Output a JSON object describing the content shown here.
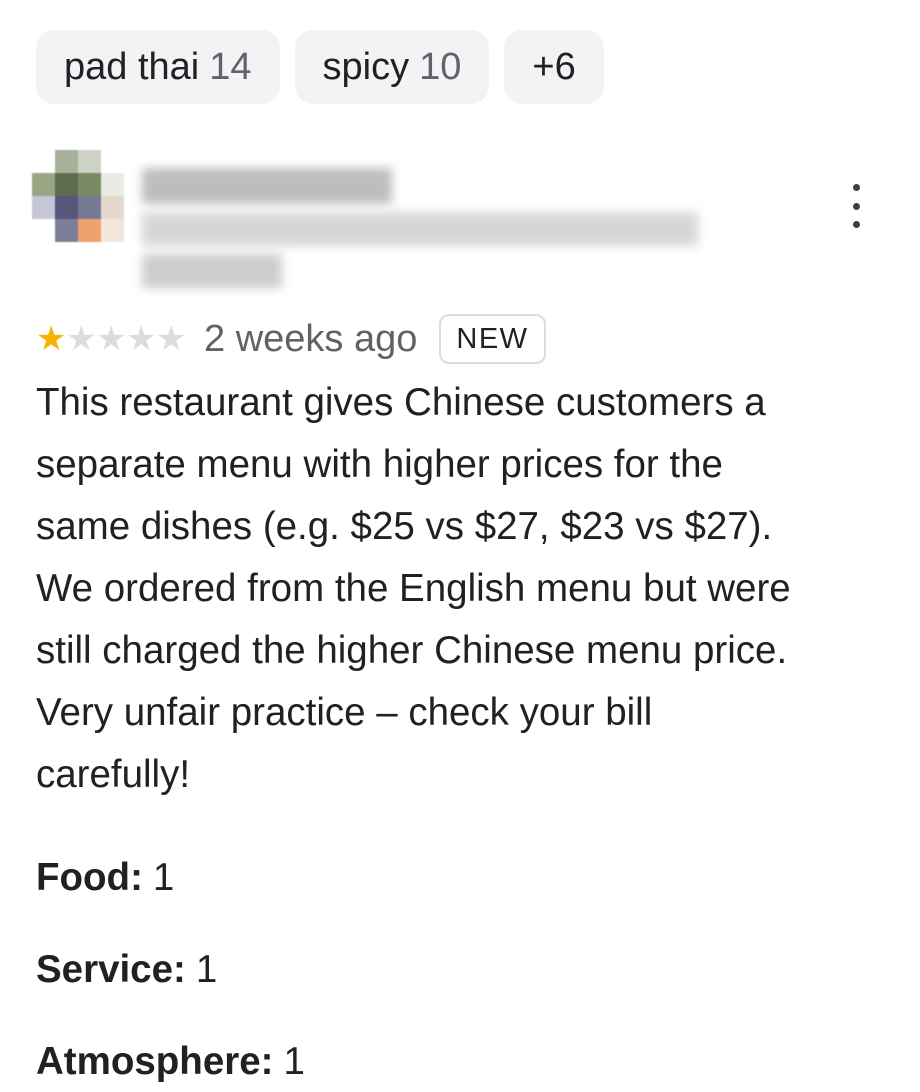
{
  "chips": [
    {
      "label": "pad thai",
      "count": "14"
    },
    {
      "label": "spicy",
      "count": "10"
    },
    {
      "label": "+6",
      "count": ""
    }
  ],
  "reviewer": {
    "avatar_icon": "blurred-avatar-icon",
    "name_redacted": true,
    "more_icon": "more-vert-icon"
  },
  "review": {
    "rating": 1,
    "rating_max": 5,
    "star_filled": "★",
    "star_empty": "★",
    "date": "2 weeks ago",
    "badge": "NEW",
    "text_lines": [
      "This restaurant gives Chinese customers a",
      "separate menu with higher prices for the",
      "same dishes (e.g. $25 vs $27, $23 vs $27).",
      "We ordered from the English menu but were",
      "still charged the higher Chinese menu price.",
      "Very unfair practice – check your bill",
      "carefully!"
    ]
  },
  "sub_ratings": [
    {
      "label": "Food:",
      "value": "1"
    },
    {
      "label": "Service:",
      "value": "1"
    },
    {
      "label": "Atmosphere:",
      "value": "1"
    }
  ],
  "colors": {
    "star": "#f6b301",
    "star_empty": "#dadce0",
    "chip_bg": "#f1f3f4"
  }
}
